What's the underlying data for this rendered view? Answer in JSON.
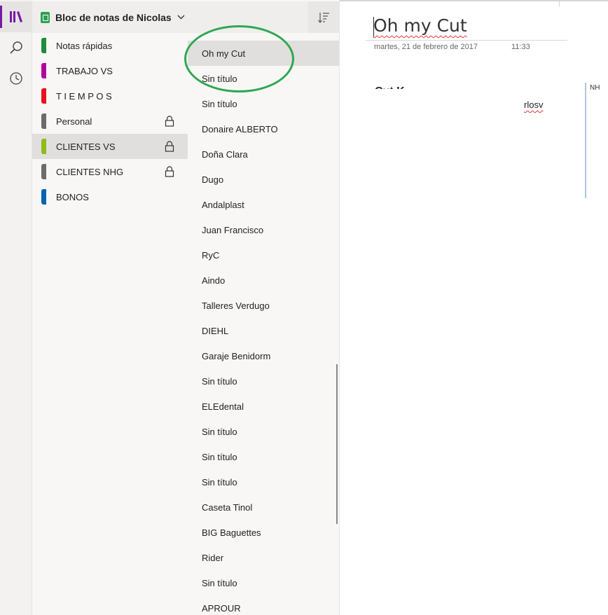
{
  "nav": {
    "items": [
      {
        "name": "notebooks",
        "icon": "notebooks-icon",
        "active": true
      },
      {
        "name": "search",
        "icon": "search-icon",
        "active": false
      },
      {
        "name": "recent",
        "icon": "clock-icon",
        "active": false
      }
    ]
  },
  "notebook": {
    "title": "Bloc de notas de Nicolas",
    "icon": "notebook-icon",
    "color": "#2e9e4f"
  },
  "sections": [
    {
      "label": "Notas rápidas",
      "color": "#1e8c3a",
      "locked": false,
      "selected": false
    },
    {
      "label": "TRABAJO VS",
      "color": "#b4009e",
      "locked": false,
      "selected": false
    },
    {
      "label": "T I E M P O S",
      "color": "#e81123",
      "locked": false,
      "selected": false
    },
    {
      "label": "Personal",
      "color": "#6b6b6b",
      "locked": true,
      "selected": false
    },
    {
      "label": "CLIENTES VS",
      "color": "#8cbd18",
      "locked": true,
      "selected": true
    },
    {
      "label": "CLIENTES NHG",
      "color": "#6b6b6b",
      "locked": true,
      "selected": false
    },
    {
      "label": "BONOS",
      "color": "#0063b1",
      "locked": false,
      "selected": false
    }
  ],
  "pages": [
    {
      "label": "Oh my Cut",
      "selected": true
    },
    {
      "label": "Sin título"
    },
    {
      "label": "Sin título"
    },
    {
      "label": "Donaire ALBERTO"
    },
    {
      "label": "Doña Clara"
    },
    {
      "label": "Dugo"
    },
    {
      "label": "Andalplast"
    },
    {
      "label": "Juan Francisco"
    },
    {
      "label": "RyC"
    },
    {
      "label": "Aindo"
    },
    {
      "label": "Talleres Verdugo"
    },
    {
      "label": "DIEHL"
    },
    {
      "label": "Garaje Benidorm"
    },
    {
      "label": "Sin título"
    },
    {
      "label": "ELEdental"
    },
    {
      "label": "Sin título"
    },
    {
      "label": "Sin título"
    },
    {
      "label": "Sin título"
    },
    {
      "label": "Caseta Tinol"
    },
    {
      "label": "BIG Baguettes"
    },
    {
      "label": "Rider"
    },
    {
      "label": "Sin título"
    },
    {
      "label": "APROUR"
    }
  ],
  "page": {
    "title": "Oh my Cut",
    "date": "martes, 21 de febrero de 2017",
    "time": "11:33",
    "content_heading": "Cut K",
    "content_text": "rlosv",
    "author_initials": "NH"
  },
  "colors": {
    "accent": "#7719aa",
    "highlight_circle": "#2fa84f",
    "author_bar": "#a9c6e6"
  }
}
